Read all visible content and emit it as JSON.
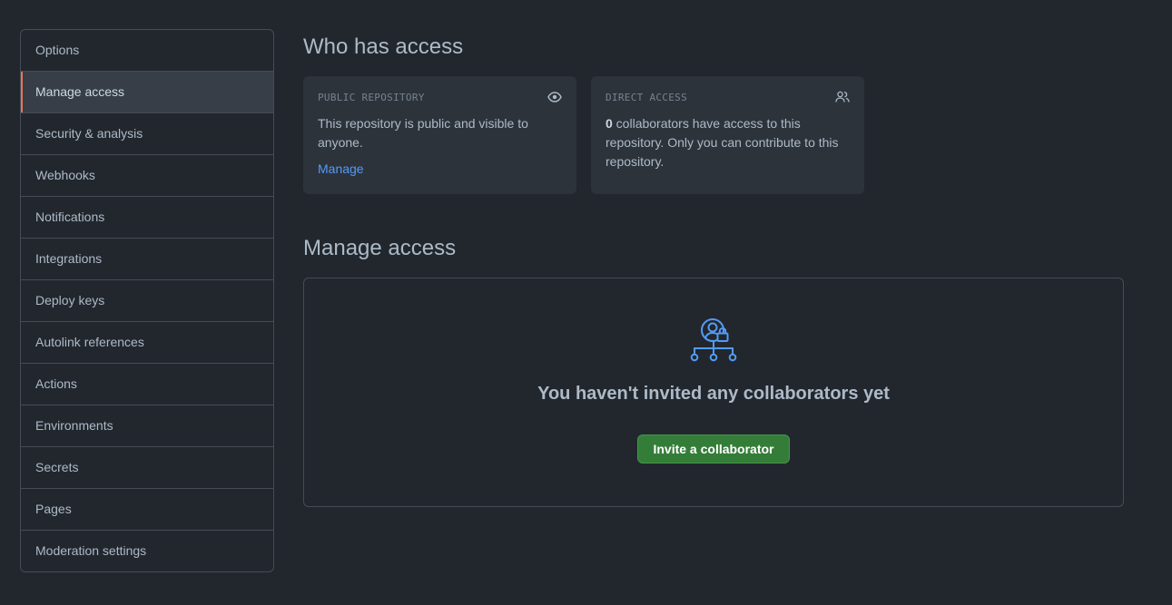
{
  "sidebar": {
    "items": [
      {
        "label": "Options"
      },
      {
        "label": "Manage access",
        "selected": true
      },
      {
        "label": "Security & analysis"
      },
      {
        "label": "Webhooks"
      },
      {
        "label": "Notifications"
      },
      {
        "label": "Integrations"
      },
      {
        "label": "Deploy keys"
      },
      {
        "label": "Autolink references"
      },
      {
        "label": "Actions"
      },
      {
        "label": "Environments"
      },
      {
        "label": "Secrets"
      },
      {
        "label": "Pages"
      },
      {
        "label": "Moderation settings"
      }
    ],
    "selected_indicator_color": "#e5755b"
  },
  "who_has_access": {
    "title": "Who has access",
    "public_card": {
      "label": "PUBLIC REPOSITORY",
      "icon": "eye-icon",
      "text": "This repository is public and visible to anyone.",
      "link": "Manage"
    },
    "direct_card": {
      "label": "DIRECT ACCESS",
      "icon": "people-icon",
      "count": "0",
      "text": " collaborators have access to this repository. Only you can contribute to this repository."
    }
  },
  "manage_access": {
    "title": "Manage access",
    "empty_icon": "person-lock-org-icon",
    "empty_title": "You haven't invited any collaborators yet",
    "invite_button": "Invite a collaborator",
    "button_color": "#347d39",
    "icon_color": "#539bf5"
  }
}
